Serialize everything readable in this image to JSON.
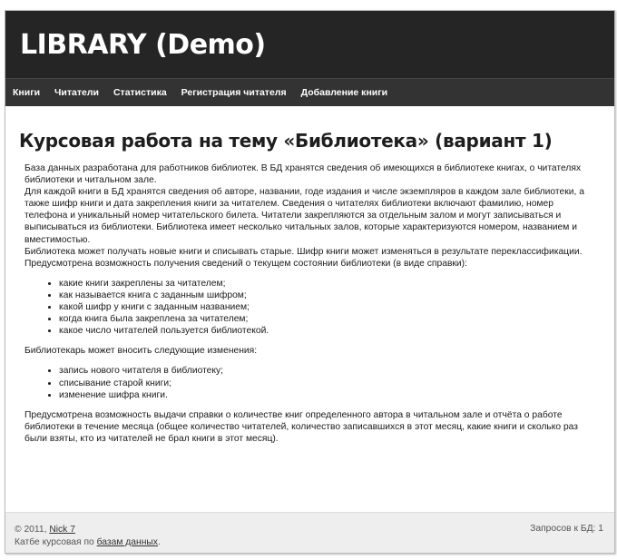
{
  "header": {
    "title": "LIBRARY (Demo)"
  },
  "nav": {
    "items": [
      "Книги",
      "Читатели",
      "Статистика",
      "Регистрация читателя",
      "Добавление книги"
    ]
  },
  "main": {
    "heading": "Курсовая работа на тему «Библиотека» (вариант 1)",
    "intro": [
      "База данных разработана для работников библиотек. В БД хранятся сведения об имеющихся в библиотеке книгах, о читателях библиотеки и читальном зале.",
      "Для каждой книги в БД хранятся сведения об авторе, названии, годе издания и числе экземпляров в каждом зале библиотеки, а также шифр книги и дата закрепления книги за читателем. Сведения о читателях библиотеки включают фамилию, номер телефона и уникальный номер читательского билета. Читатели закрепляются за отдельным залом и могут записываться и выписываться из библиотеки. Библиотека имеет несколько читальных залов, которые характеризуются номером, названием и вместимостью.",
      "Библиотека может получать новые книги и списывать старые. Шифр книги может изменяться в результате переклассификации.",
      "Предусмотрена возможность получения сведений о текущем состоянии библиотеки (в виде справки):"
    ],
    "list1": [
      "какие книги закреплены за читателем;",
      "как называется книга с заданным шифром;",
      "какой шифр у книги с заданным названием;",
      "когда книга была закреплена за читателем;",
      "какое число читателей пользуется библиотекой."
    ],
    "librarian_intro": "Библиотекарь может вносить следующие изменения:",
    "list2": [
      "запись нового читателя в библиотеку;",
      "списывание старой книги;",
      "изменение шифра книги."
    ],
    "outro": "Предусмотрена возможность выдачи справки о количестве книг определенного автора в читальном зале и отчёта о работе библиотеки в течение месяца (общее количество читателей, количество записавшихся в этот месяц, какие книги и сколько раз были взяты, кто из читателей не брал книги в этот месяц)."
  },
  "footer": {
    "copyright_prefix": "© 2011, ",
    "author_link": "Nick 7",
    "line2_prefix": "Катбе курсовая по ",
    "db_link": "базам данных",
    "line2_suffix": ".",
    "queries": "Запросов к БД: 1"
  }
}
